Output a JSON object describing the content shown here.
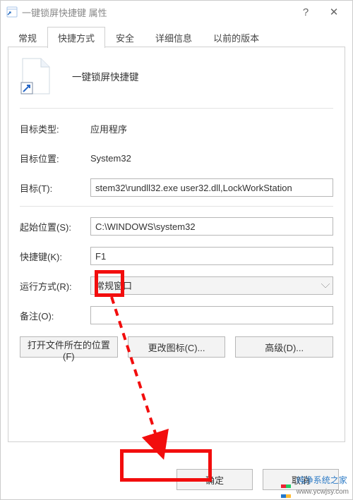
{
  "window": {
    "title": "一键锁屏快捷键 属性"
  },
  "tabs": [
    {
      "label": "常规"
    },
    {
      "label": "快捷方式"
    },
    {
      "label": "安全"
    },
    {
      "label": "详细信息"
    },
    {
      "label": "以前的版本"
    }
  ],
  "active_tab_index": 1,
  "shortcut": {
    "display_name": "一键锁屏快捷键",
    "target_type_label": "目标类型:",
    "target_type_value": "应用程序",
    "target_location_label": "目标位置:",
    "target_location_value": "System32",
    "target_label": "目标(T):",
    "target_value": "stem32\\rundll32.exe user32.dll,LockWorkStation",
    "start_in_label": "起始位置(S):",
    "start_in_value": "C:\\WINDOWS\\system32",
    "shortcut_key_label": "快捷键(K):",
    "shortcut_key_value": "F1",
    "run_label": "运行方式(R):",
    "run_value": "常规窗口",
    "comment_label": "备注(O):",
    "comment_value": ""
  },
  "buttons": {
    "open_file_location": "打开文件所在的位置(F)",
    "change_icon": "更改图标(C)...",
    "advanced": "高级(D)..."
  },
  "footer": {
    "ok": "确定",
    "cancel": "取消"
  },
  "annotation": {
    "highlight_color": "#f20d0d"
  },
  "watermark": {
    "text": "纯净系统之家",
    "url": "www.ycwjsy.com"
  }
}
